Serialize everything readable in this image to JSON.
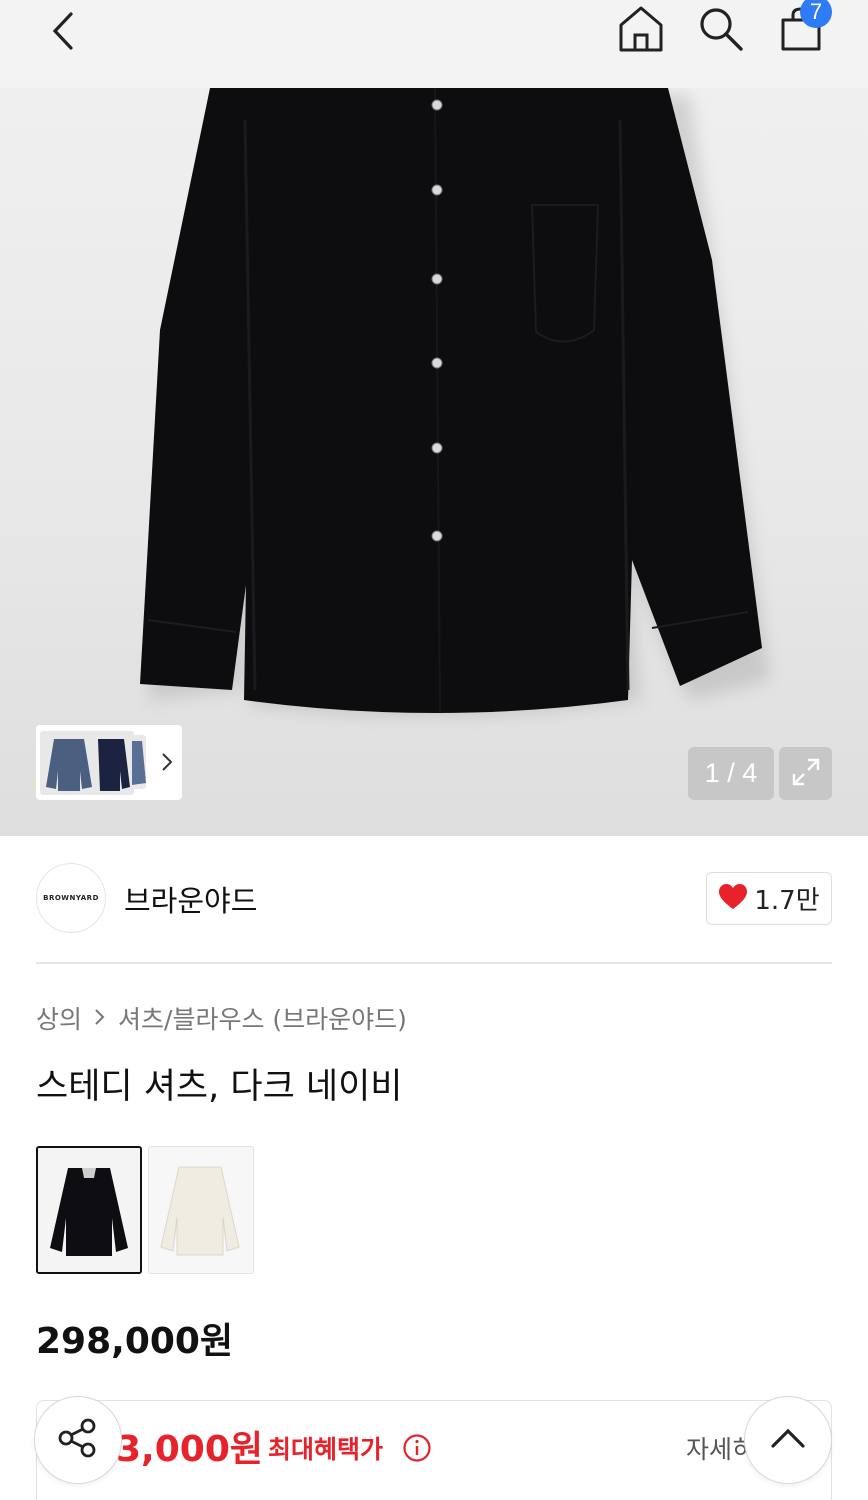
{
  "nav": {
    "back_icon": "chevron-left-icon",
    "home_icon": "home-icon",
    "search_icon": "search-icon",
    "cart_icon": "shopping-bag-icon",
    "cart_count": "7"
  },
  "gallery": {
    "counter": "1 / 4",
    "expand_icon": "expand-icon"
  },
  "brand": {
    "logo_text": "BROWNYARD",
    "name": "브라운야드",
    "like_count": "1.7만",
    "like_color": "#e8222a"
  },
  "breadcrumb": {
    "level1": "상의",
    "level2": "셔츠/블라우스 (브라운야드)"
  },
  "product": {
    "title": "스테디 셔츠, 다크 네이비",
    "price": "298,000원"
  },
  "benefit": {
    "price": "3,000원",
    "label": "최대혜택가",
    "detail_link": "자세히"
  },
  "colors": {
    "accent": "#2f7bf5",
    "sale": "#e8222a"
  }
}
